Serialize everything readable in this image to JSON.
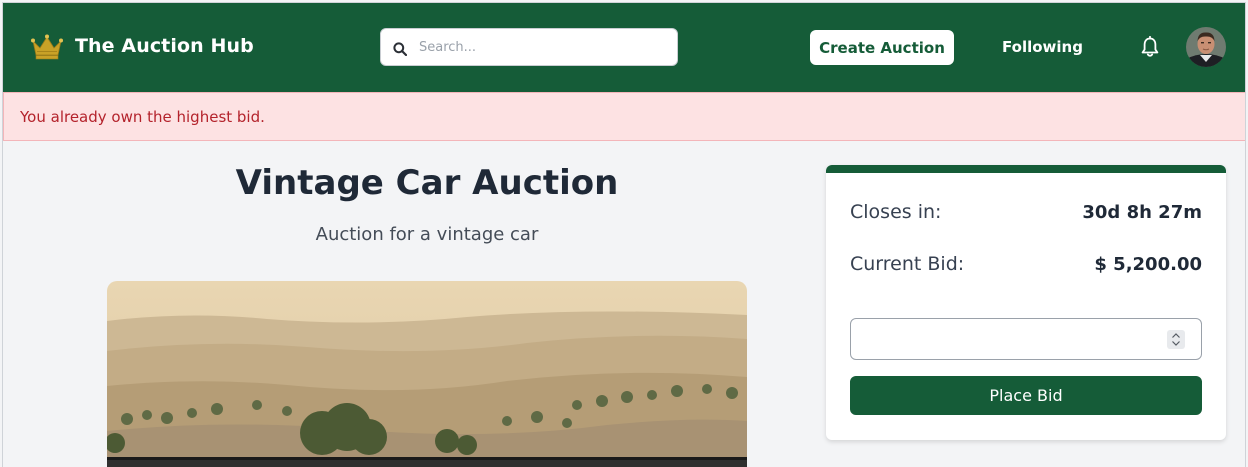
{
  "header": {
    "brand": {
      "title": "The Auction Hub",
      "icon": "crown-icon"
    },
    "search": {
      "placeholder": "Search...",
      "value": ""
    },
    "nav": {
      "create_label": "Create Auction",
      "following_label": "Following",
      "notifications_icon": "bell-icon",
      "avatar_icon": "user-avatar"
    }
  },
  "alert": {
    "message": "You already own the highest bid."
  },
  "auction": {
    "title": "Vintage Car Auction",
    "description": "Auction for a vintage car"
  },
  "bid_panel": {
    "closes_label": "Closes in:",
    "closes_value": "30d 8h 27m",
    "current_bid_label": "Current Bid:",
    "current_bid_value": "$ 5,200.00",
    "bid_input_value": "",
    "place_bid_label": "Place Bid"
  },
  "colors": {
    "brand_green": "#155c38",
    "alert_bg": "#fde2e3",
    "alert_text": "#b4232c",
    "crown_gold": "#c9a227"
  }
}
